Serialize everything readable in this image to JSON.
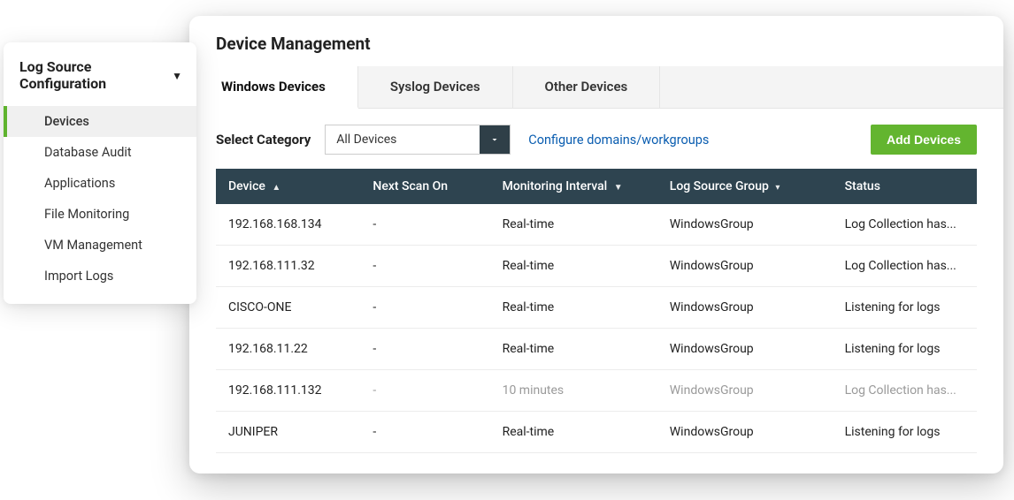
{
  "sidebar": {
    "title": "Log Source Configuration",
    "items": [
      {
        "label": "Devices",
        "active": true
      },
      {
        "label": "Database Audit",
        "active": false
      },
      {
        "label": "Applications",
        "active": false
      },
      {
        "label": "File Monitoring",
        "active": false
      },
      {
        "label": "VM Management",
        "active": false
      },
      {
        "label": "Import Logs",
        "active": false
      }
    ]
  },
  "main": {
    "title": "Device Management",
    "tabs": [
      {
        "label": "Windows Devices",
        "active": true
      },
      {
        "label": "Syslog Devices",
        "active": false
      },
      {
        "label": "Other Devices",
        "active": false
      }
    ],
    "toolbar": {
      "category_label": "Select Category",
      "category_value": "All Devices",
      "configure_link": "Configure domains/workgroups",
      "add_button": "Add Devices"
    },
    "table": {
      "columns": [
        "Device",
        "Next Scan On",
        "Monitoring Interval",
        "Log Source Group",
        "Status"
      ],
      "rows": [
        {
          "device": "192.168.168.134",
          "scan": "-",
          "interval": "Real-time",
          "group": "WindowsGroup",
          "status": "Log Collection has...",
          "status_class": "red",
          "dim": false
        },
        {
          "device": "192.168.111.32",
          "scan": "-",
          "interval": "Real-time",
          "group": "WindowsGroup",
          "status": "Log Collection has...",
          "status_class": "red",
          "dim": false
        },
        {
          "device": "CISCO-ONE",
          "scan": "-",
          "interval": "Real-time",
          "group": "WindowsGroup",
          "status": "Listening for logs",
          "status_class": "green",
          "dim": false
        },
        {
          "device": "192.168.11.22",
          "scan": "-",
          "interval": "Real-time",
          "group": "WindowsGroup",
          "status": "Listening for logs",
          "status_class": "green",
          "dim": false
        },
        {
          "device": "192.168.111.132",
          "scan": "-",
          "interval": "10 minutes",
          "group": "WindowsGroup",
          "status": "Log Collection has...",
          "status_class": "red",
          "dim": true
        },
        {
          "device": "JUNIPER",
          "scan": "-",
          "interval": "Real-time",
          "group": "WindowsGroup",
          "status": "Listening for logs",
          "status_class": "green",
          "dim": false
        }
      ]
    }
  }
}
